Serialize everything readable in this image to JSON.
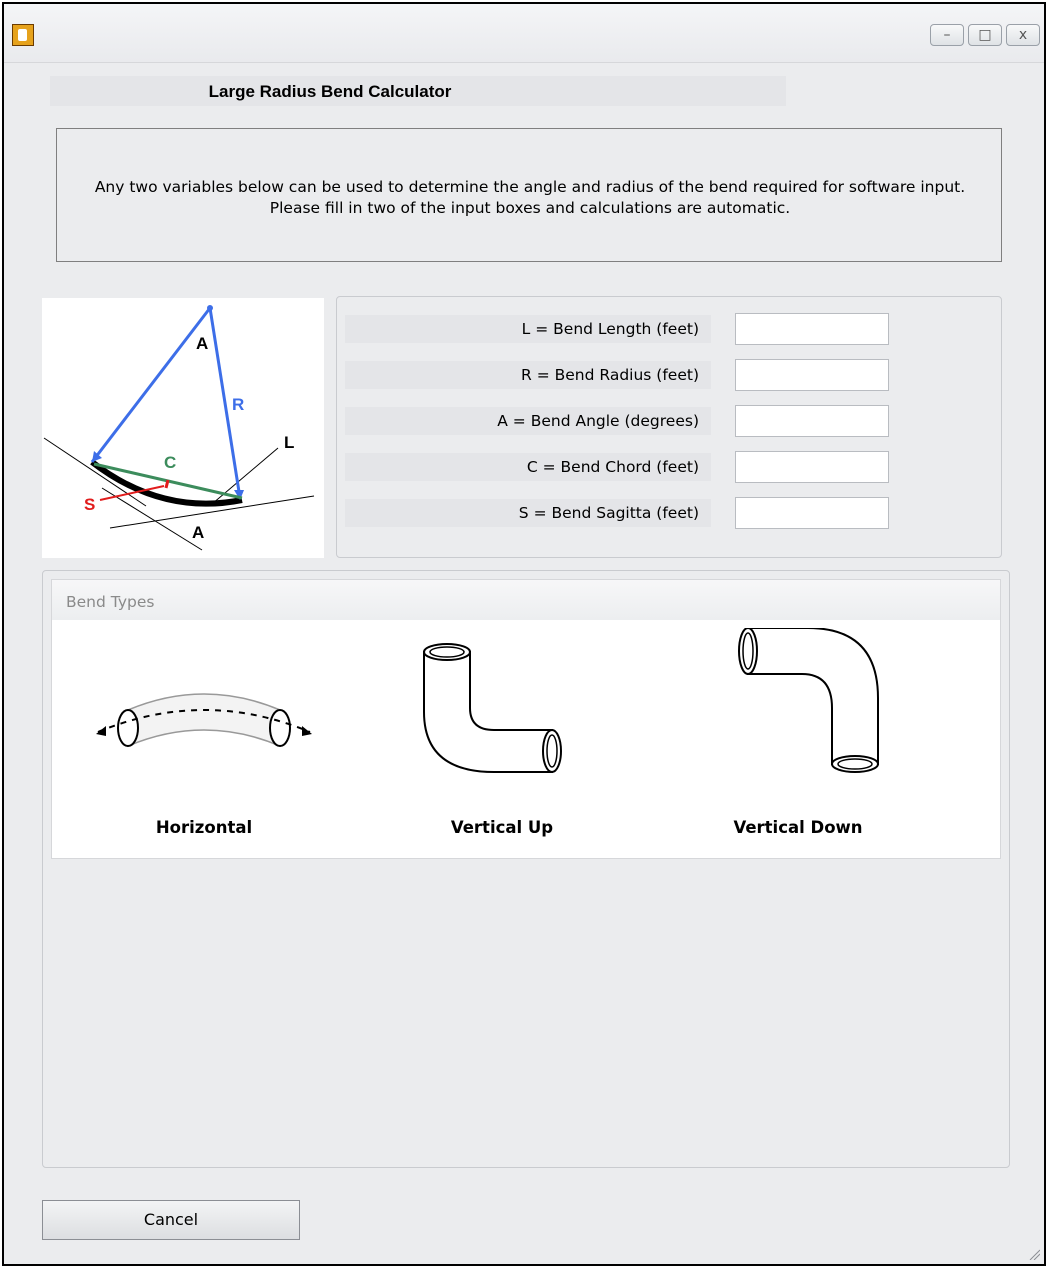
{
  "window": {
    "title": "",
    "controls": {
      "minimize": "–",
      "maximize": "□",
      "close": "x"
    }
  },
  "heading": "Large Radius Bend Calculator",
  "instructions": "Any two variables below can be used to determine the angle and radius of the bend required for software input.  Please fill in two of the input boxes and calculations are automatic.",
  "diagram": {
    "labels": {
      "angle_top": "A",
      "radius": "R",
      "length": "L",
      "chord": "C",
      "sagitta": "S",
      "angle_bottom": "A"
    },
    "colors": {
      "radius": "#3d6ee8",
      "chord": "#3c8c5c",
      "sagitta": "#e11d1d",
      "arc": "#000000"
    }
  },
  "fields": [
    {
      "label": "L = Bend Length  (feet)",
      "value": ""
    },
    {
      "label": "R = Bend Radius  (feet)",
      "value": ""
    },
    {
      "label": "A = Bend Angle  (degrees)",
      "value": ""
    },
    {
      "label": "C = Bend Chord  (feet)",
      "value": ""
    },
    {
      "label": "S = Bend Sagitta  (feet)",
      "value": ""
    }
  ],
  "bend_types": {
    "title": "Bend Types",
    "items": [
      {
        "label": "Horizontal",
        "icon": "horizontal-bend-icon"
      },
      {
        "label": "Vertical Up",
        "icon": "vertical-up-bend-icon"
      },
      {
        "label": "Vertical Down",
        "icon": "vertical-down-bend-icon"
      }
    ]
  },
  "cancel_label": "Cancel"
}
